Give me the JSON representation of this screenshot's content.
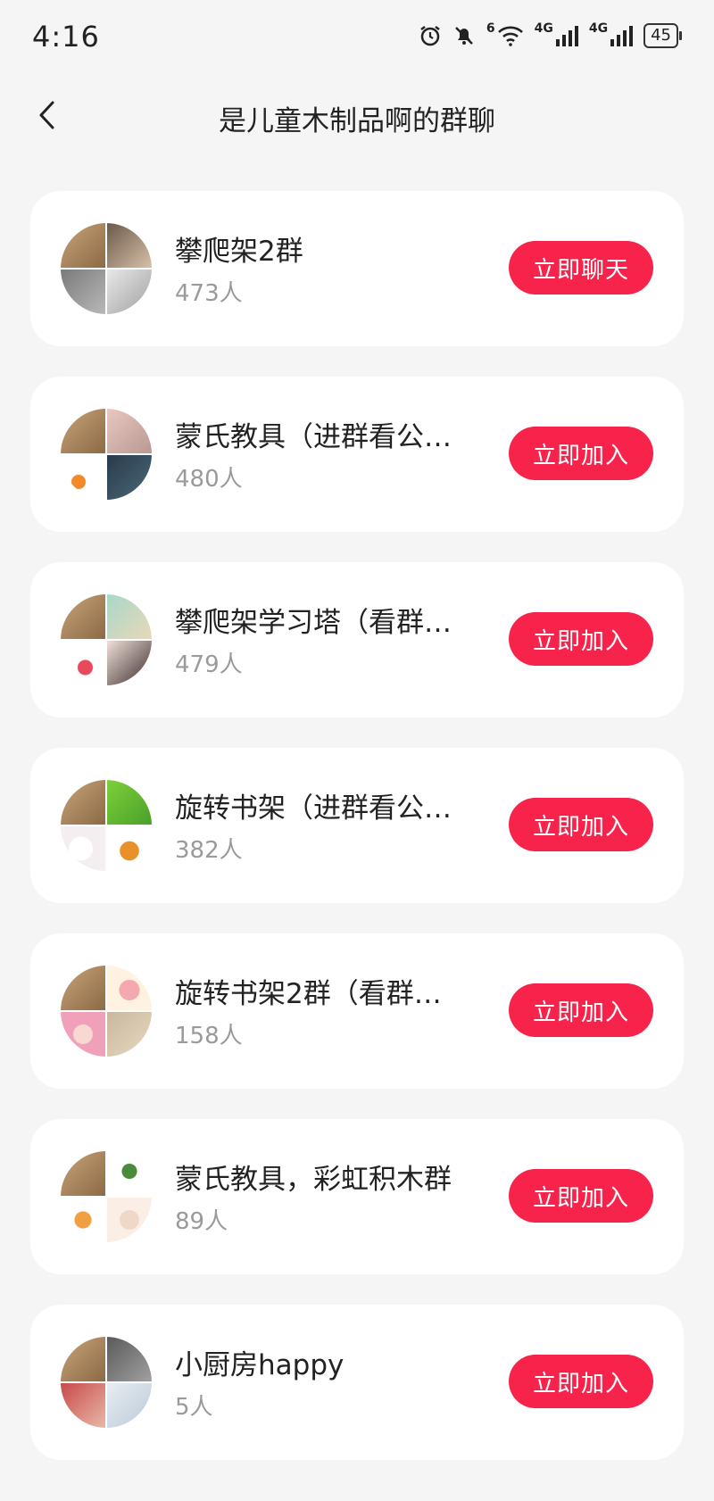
{
  "status": {
    "time": "4:16",
    "network1": "6",
    "network2": "4G",
    "network3": "4G",
    "battery": "45"
  },
  "header": {
    "title": "是儿童木制品啊的群聊"
  },
  "groups": [
    {
      "name": "攀爬架2群",
      "count": "473人",
      "action": "立即聊天"
    },
    {
      "name": "蒙氏教具（进群看公…",
      "count": "480人",
      "action": "立即加入"
    },
    {
      "name": "攀爬架学习塔（看群…",
      "count": "479人",
      "action": "立即加入"
    },
    {
      "name": "旋转书架（进群看公…",
      "count": "382人",
      "action": "立即加入"
    },
    {
      "name": "旋转书架2群（看群…",
      "count": "158人",
      "action": "立即加入"
    },
    {
      "name": "蒙氏教具，彩虹积木群",
      "count": "89人",
      "action": "立即加入"
    },
    {
      "name": "小厨房happy",
      "count": "5人",
      "action": "立即加入"
    }
  ],
  "colors": {
    "accent": "#f7234b",
    "background": "#f5f5f5",
    "card": "#ffffff",
    "muted_text": "#9a9a9a"
  }
}
